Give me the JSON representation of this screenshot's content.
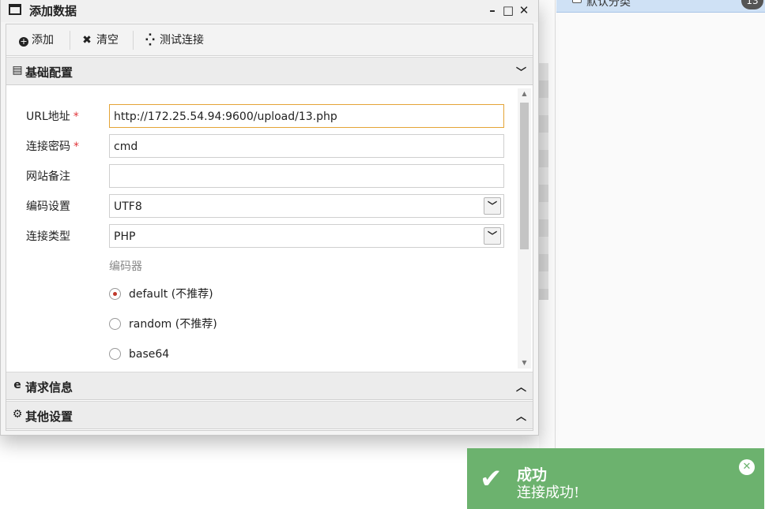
{
  "background": {
    "category_label": "默认分类",
    "category_count": "13"
  },
  "window": {
    "title": "添加数据",
    "minimize": "–",
    "maximize": "□",
    "close": "✕"
  },
  "toolbar": {
    "add_label": "添加",
    "clear_label": "清空",
    "test_label": "测试连接"
  },
  "sections": {
    "basic": "基础配置",
    "request": "请求信息",
    "other": "其他设置"
  },
  "form": {
    "url_label": "URL地址",
    "url_value": "http://172.25.54.94:9600/upload/13.php",
    "password_label": "连接密码",
    "password_value": "cmd",
    "note_label": "网站备注",
    "note_value": "",
    "encoding_label": "编码设置",
    "encoding_value": "UTF8",
    "type_label": "连接类型",
    "type_value": "PHP",
    "required_mark": "*",
    "encoder_title": "编码器",
    "encoders": [
      {
        "label": "default (不推荐)",
        "selected": true
      },
      {
        "label": "random (不推荐)",
        "selected": false
      },
      {
        "label": "base64",
        "selected": false
      }
    ]
  },
  "toast": {
    "title": "成功",
    "message": "连接成功!",
    "color": "#6cb26e"
  },
  "colors": {
    "focus_border": "#e4a436",
    "required": "#e0353a"
  }
}
